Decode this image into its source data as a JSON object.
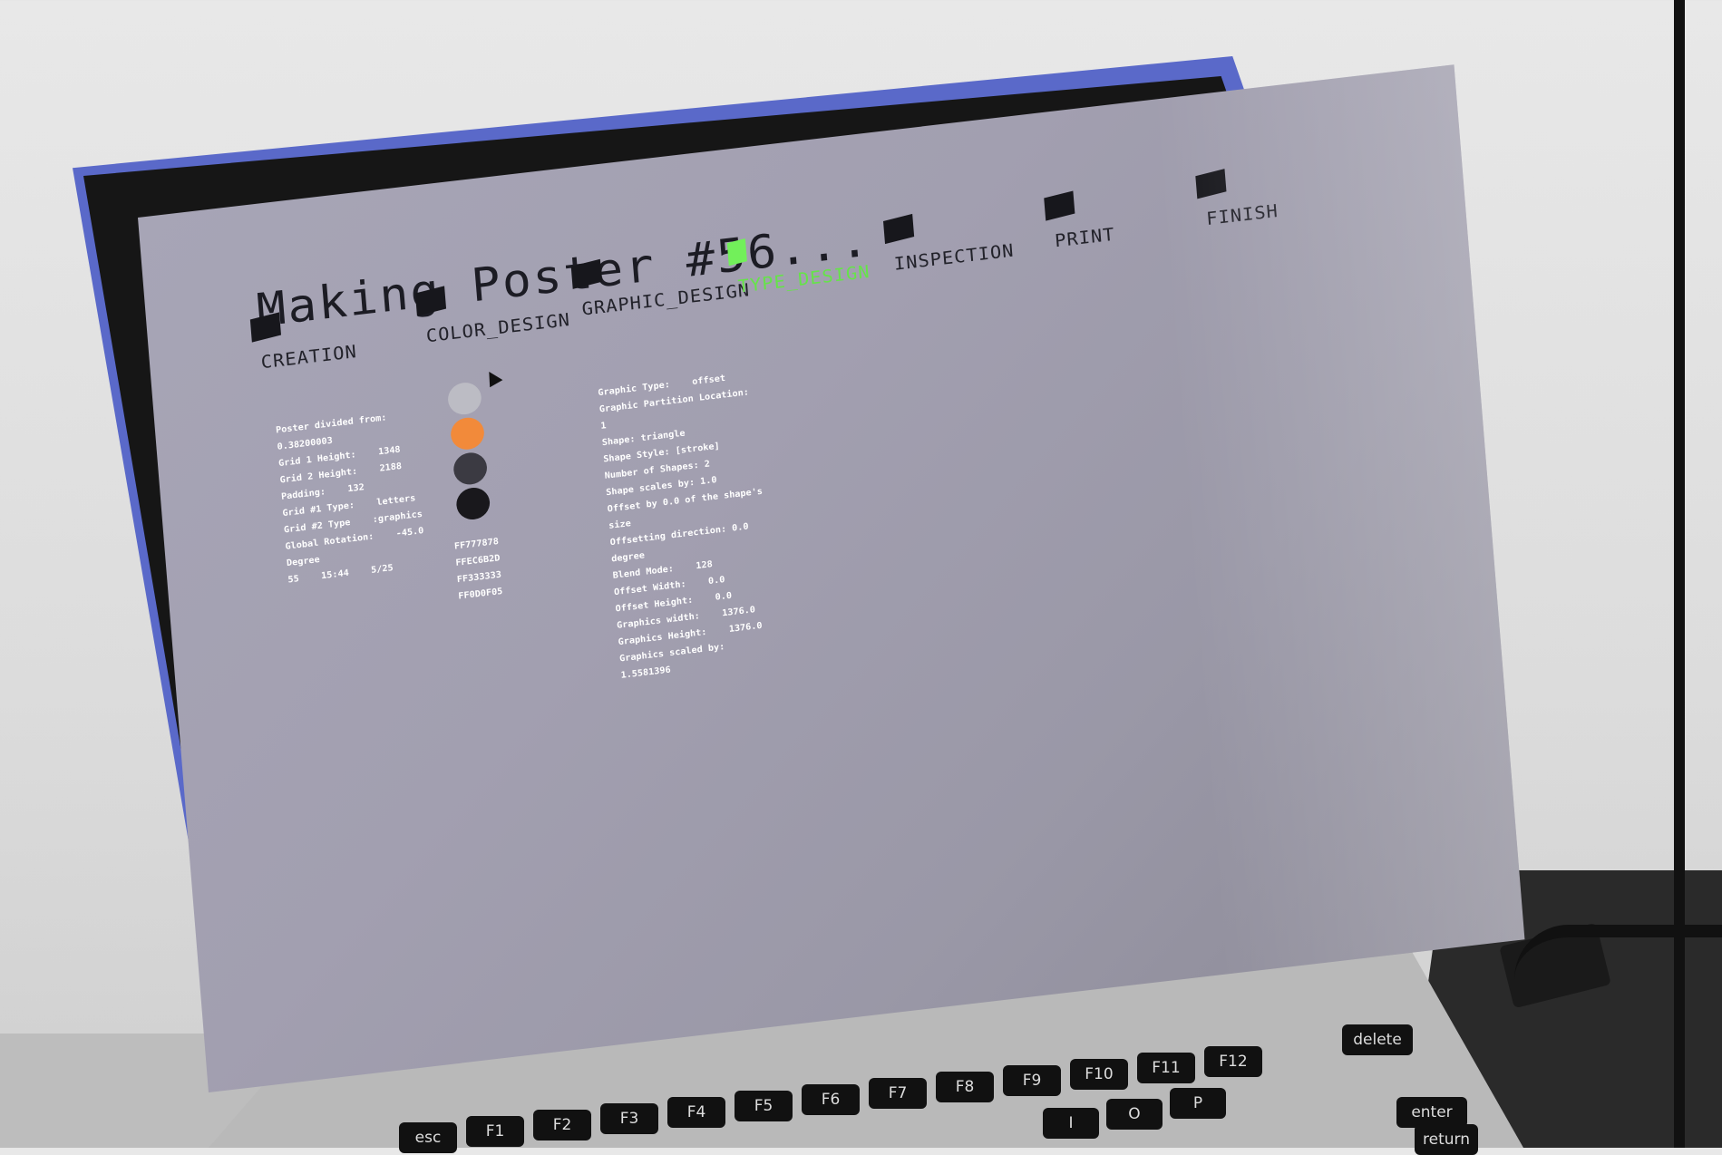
{
  "app": {
    "title": "Making Poster #56..."
  },
  "steps": [
    {
      "label": "CREATION",
      "active": false
    },
    {
      "label": "COLOR_DESIGN",
      "active": false
    },
    {
      "label": "GRAPHIC_DESIGN",
      "active": false
    },
    {
      "label": "TYPE_DESIGN",
      "active": true
    },
    {
      "label": "INSPECTION",
      "active": false
    },
    {
      "label": "PRINT",
      "active": false
    },
    {
      "label": "FINISH",
      "active": false
    }
  ],
  "grid_panel": {
    "lines": [
      "Poster divided from:",
      "0.38200003",
      "Grid 1 Height:    1348",
      "Grid 2 Height:    2188",
      "Padding:    132",
      "Grid #1 Type:    letters",
      "Grid #2 Type    :graphics",
      "Global Rotation:    -45.0",
      "Degree",
      "55    15:44    5/25"
    ]
  },
  "color_panel": {
    "swatches": [
      {
        "color": "#bcbcc4"
      },
      {
        "color": "#f28a3a"
      },
      {
        "color": "#3b3a42"
      },
      {
        "color": "#19181c"
      }
    ],
    "codes": [
      "FF777878",
      "FFEC6B2D",
      "FF333333",
      "FF0D0F05"
    ]
  },
  "graphic_panel": {
    "lines": [
      "Graphic Type:    offset",
      "Graphic Partition Location:",
      "1",
      "Shape: triangle",
      "Shape Style: [stroke]",
      "Number of Shapes: 2",
      "Shape scales by: 1.0",
      "Offset by 0.0 of the shape's",
      "size",
      "Offsetting direction: 0.0",
      "degree",
      "Blend Mode:    128",
      "Offset Width:    0.0",
      "Offset Height:    0.0",
      "Graphics width:    1376.0",
      "Graphics Height:    1376.0",
      "Graphics scaled by:",
      "1.5581396"
    ]
  },
  "keyboard": {
    "fn_row": [
      "esc",
      "F1",
      "F2",
      "F3",
      "F4",
      "F5",
      "F6",
      "F7",
      "F8",
      "F9",
      "F10",
      "F11",
      "F12"
    ],
    "keys": [
      "delete",
      "enter",
      "return",
      "P",
      "O",
      "I"
    ]
  },
  "colors": {
    "accent": "#72f05a",
    "screen_bg": "#a29fb0",
    "text": "#1c1c24"
  }
}
